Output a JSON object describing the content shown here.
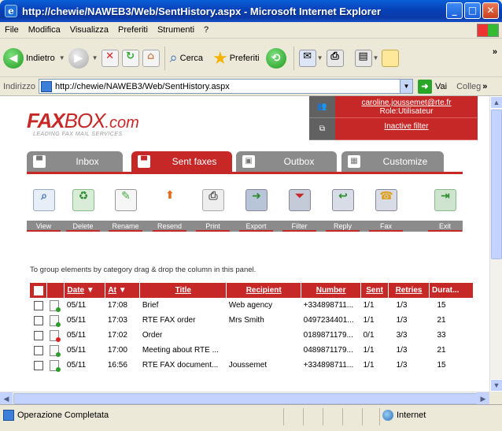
{
  "window": {
    "title": "http://chewie/NAWEB3/Web/SentHistory.aspx - Microsoft Internet Explorer",
    "buttons": {
      "minimize": "_",
      "maximize": "□",
      "close": "✕"
    }
  },
  "menu": [
    "File",
    "Modifica",
    "Visualizza",
    "Preferiti",
    "Strumenti",
    "?"
  ],
  "toolbar": {
    "back": "Indietro",
    "search": "Cerca",
    "favorites": "Preferiti"
  },
  "address": {
    "label": "Indirizzo",
    "url": "http://chewie/NAWEB3/Web/SentHistory.aspx",
    "go": "Vai",
    "links": "Colleg"
  },
  "status": {
    "message": "Operazione Completata",
    "zone": "Internet"
  },
  "app": {
    "logo": {
      "fax": "FAX",
      "box": "BOX",
      "com": ".com",
      "tagline": "LEADING FAX MAIL SERVICES"
    },
    "user": {
      "email": "caroline.joussemet@rte.fr",
      "role": "Role:Utilisateur",
      "filter": "Inactive filter"
    },
    "tabs": [
      {
        "label": "Inbox",
        "active": false
      },
      {
        "label": "Sent faxes",
        "active": true
      },
      {
        "label": "Outbox",
        "active": false
      },
      {
        "label": "Customize",
        "active": false
      }
    ],
    "actions": [
      {
        "label": "View",
        "icon": "magnifier-icon"
      },
      {
        "label": "Delete",
        "icon": "recycle-bin-icon"
      },
      {
        "label": "Rename",
        "icon": "rename-icon"
      },
      {
        "label": "Resend",
        "icon": "resend-icon"
      },
      {
        "label": "Print",
        "icon": "printer-icon"
      },
      {
        "label": "Export",
        "icon": "export-icon"
      },
      {
        "label": "Filter",
        "icon": "filter-icon"
      },
      {
        "label": "Reply",
        "icon": "fax-reply-icon"
      },
      {
        "label": "Fax",
        "icon": "fax-icon"
      },
      {
        "label": "Exit",
        "icon": "exit-door-icon"
      }
    ],
    "group_hint": "To group elements by category drag & drop the column in this panel.",
    "columns": {
      "date": "Date",
      "at": "At",
      "title": "Title",
      "recipient": "Recipient",
      "number": "Number",
      "sent": "Sent",
      "retries": "Retries",
      "duration": "Durat..."
    },
    "rows": [
      {
        "status": "ok",
        "date": "05/11",
        "at": "17:08",
        "title": "Brief",
        "recipient": "Web agency",
        "number": "+334898711...",
        "sent": "1/1",
        "retries": "1/3",
        "duration": "15"
      },
      {
        "status": "ok",
        "date": "05/11",
        "at": "17:03",
        "title": "RTE FAX order",
        "recipient": "Mrs Smith",
        "number": "0497234401...",
        "sent": "1/1",
        "retries": "1/3",
        "duration": "21"
      },
      {
        "status": "error",
        "date": "05/11",
        "at": "17:02",
        "title": "Order",
        "recipient": "",
        "number": "0189871179...",
        "sent": "0/1",
        "retries": "3/3",
        "duration": "33"
      },
      {
        "status": "ok",
        "date": "05/11",
        "at": "17:00",
        "title": "Meeting about RTE ...",
        "recipient": "",
        "number": "0489871179...",
        "sent": "1/1",
        "retries": "1/3",
        "duration": "21"
      },
      {
        "status": "ok",
        "date": "05/11",
        "at": "16:56",
        "title": "RTE FAX document...",
        "recipient": "Joussemet",
        "number": "+334898711...",
        "sent": "1/1",
        "retries": "1/3",
        "duration": "15"
      }
    ]
  },
  "colors": {
    "brand_red": "#c62828",
    "tab_gray": "#8b8b8b",
    "xp_blue": "#0a4fc8"
  }
}
